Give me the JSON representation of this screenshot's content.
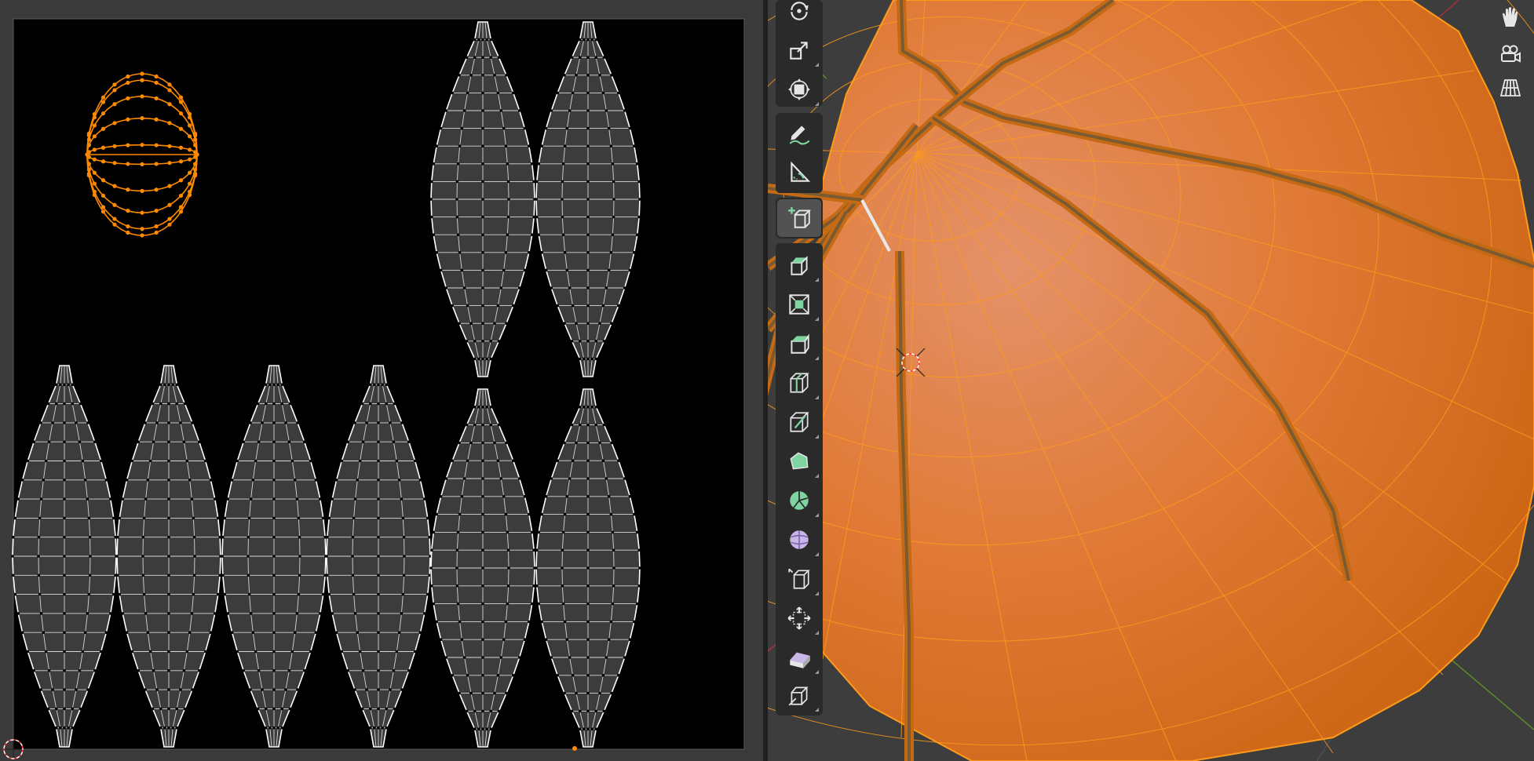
{
  "screen": {
    "width": 1954,
    "height": 970
  },
  "uv_editor": {
    "background": "#000000",
    "island_fill": "#3c3c3c",
    "edge_color": "#ffffff",
    "selected_color": "#ff8a00",
    "cursor_icon": "2d-cursor-icon"
  },
  "viewport": {
    "object": "basketball",
    "mesh_color": "#e07a30",
    "wire_color": "#ff9a1a",
    "seam_color": "#7a5a30",
    "x_axis_color": "#a83240",
    "y_axis_color": "#5c8a2a",
    "cursor_icon": "3d-cursor-icon"
  },
  "toolbar": {
    "tools": [
      {
        "name": "rotate-tool",
        "icon": "rotate-icon",
        "active": false
      },
      {
        "name": "scale-tool",
        "icon": "scale-icon",
        "active": false
      },
      {
        "name": "transform-tool",
        "icon": "transform-icon",
        "active": false
      },
      {
        "name": "annotate-tool",
        "icon": "annotate-pencil-icon",
        "active": false
      },
      {
        "name": "measure-tool",
        "icon": "measure-ruler-icon",
        "active": false
      },
      {
        "name": "add-cube-tool",
        "icon": "add-cube-icon",
        "active": true
      },
      {
        "name": "extrude-region-tool",
        "icon": "extrude-region-icon",
        "active": false
      },
      {
        "name": "inset-faces-tool",
        "icon": "inset-faces-icon",
        "active": false
      },
      {
        "name": "bevel-tool",
        "icon": "bevel-icon",
        "active": false
      },
      {
        "name": "loop-cut-tool",
        "icon": "loop-cut-icon",
        "active": false
      },
      {
        "name": "knife-tool",
        "icon": "knife-icon",
        "active": false
      },
      {
        "name": "poly-build-tool",
        "icon": "poly-build-icon",
        "active": false
      },
      {
        "name": "spin-tool",
        "icon": "spin-icon",
        "active": false
      },
      {
        "name": "smooth-tool",
        "icon": "smooth-vertices-icon",
        "active": false
      },
      {
        "name": "edge-slide-tool",
        "icon": "edge-slide-icon",
        "active": false
      },
      {
        "name": "shrink-fatten-tool",
        "icon": "shrink-fatten-icon",
        "active": false
      },
      {
        "name": "shear-tool",
        "icon": "shear-icon",
        "active": false
      },
      {
        "name": "rip-region-tool",
        "icon": "rip-region-icon",
        "active": false
      }
    ]
  },
  "nav_gizmos": [
    {
      "name": "pan-view-button",
      "icon": "hand-icon"
    },
    {
      "name": "camera-view-button",
      "icon": "camera-icon"
    },
    {
      "name": "perspective-toggle-button",
      "icon": "grid-icon"
    }
  ]
}
